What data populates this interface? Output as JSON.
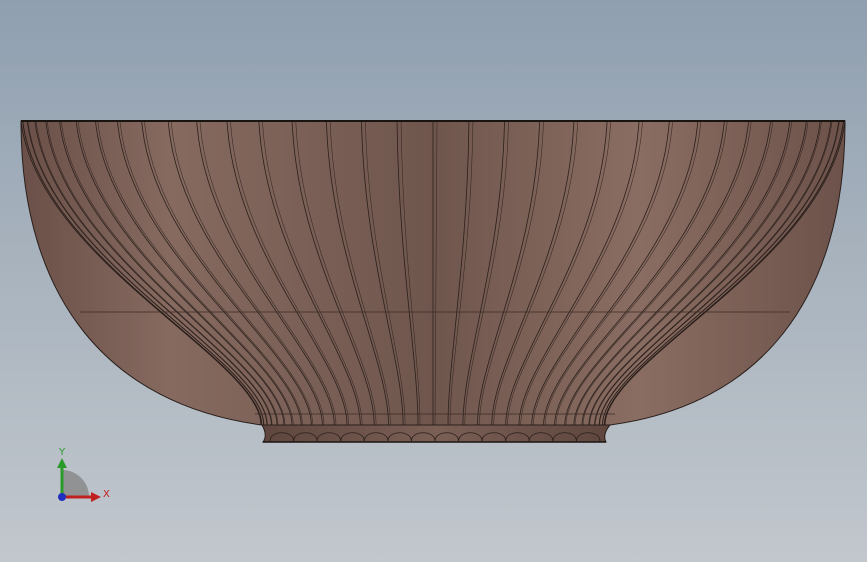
{
  "viewport": {
    "background_top": "#8f9fb0",
    "background_bottom": "#c2c7cd"
  },
  "model": {
    "kind": "fluted-bowl",
    "body_color": "#7e6257",
    "edge_color": "#2a1f1b",
    "flute_count": 36,
    "foot_scallops": 14
  },
  "triad": {
    "x_label": "X",
    "y_label": "Y",
    "x_color": "#c0201f",
    "y_color": "#2a9a2a",
    "z_color": "#1f2fc0"
  }
}
